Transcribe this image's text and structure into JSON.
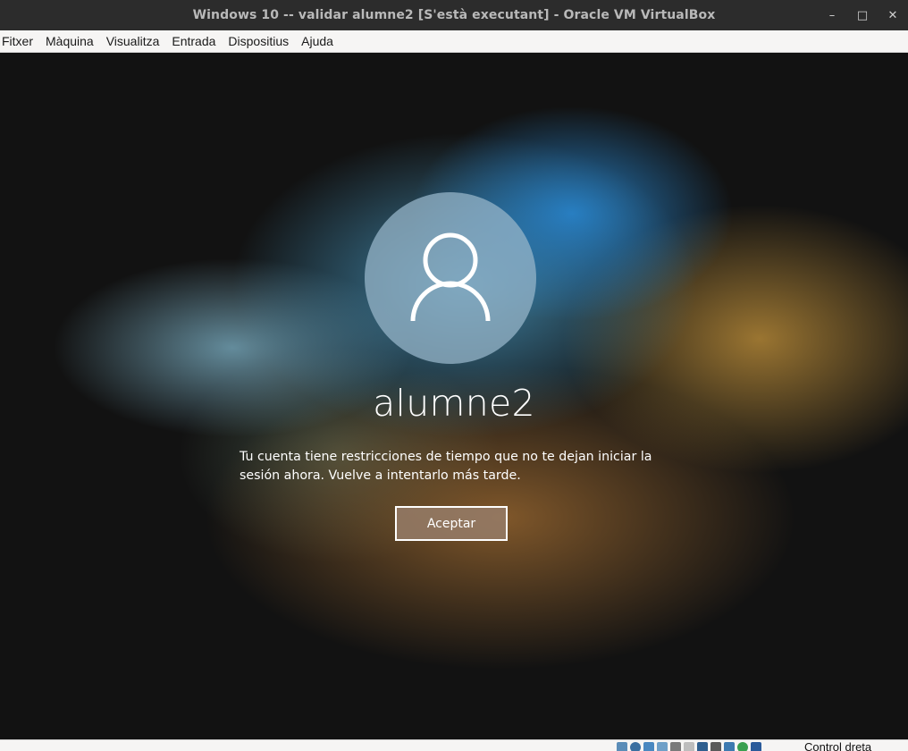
{
  "window": {
    "title": "Windows 10 -- validar alumne2 [S'està executant] - Oracle VM VirtualBox",
    "controls": {
      "minimize": "–",
      "maximize": "□",
      "close": "✕"
    }
  },
  "menu": [
    "Fitxer",
    "Màquina",
    "Visualitza",
    "Entrada",
    "Dispositius",
    "Ajuda"
  ],
  "login": {
    "avatar_icon": "user-icon",
    "username": "alumne2",
    "message": "Tu cuenta tiene restricciones de tiempo que no te dejan iniciar la sesión ahora. Vuelve a intentarlo más tarde.",
    "button_label": "Aceptar"
  },
  "statusbar": {
    "icons": [
      "hard-disk-icon",
      "optical-drive-icon",
      "audio-icon",
      "network-icon",
      "usb-icon",
      "shared-folders-icon",
      "display-icon",
      "video-capture-icon",
      "cpu-icon",
      "mouse-integration-icon",
      "keyboard-icon"
    ],
    "host_key": "Control dreta"
  }
}
